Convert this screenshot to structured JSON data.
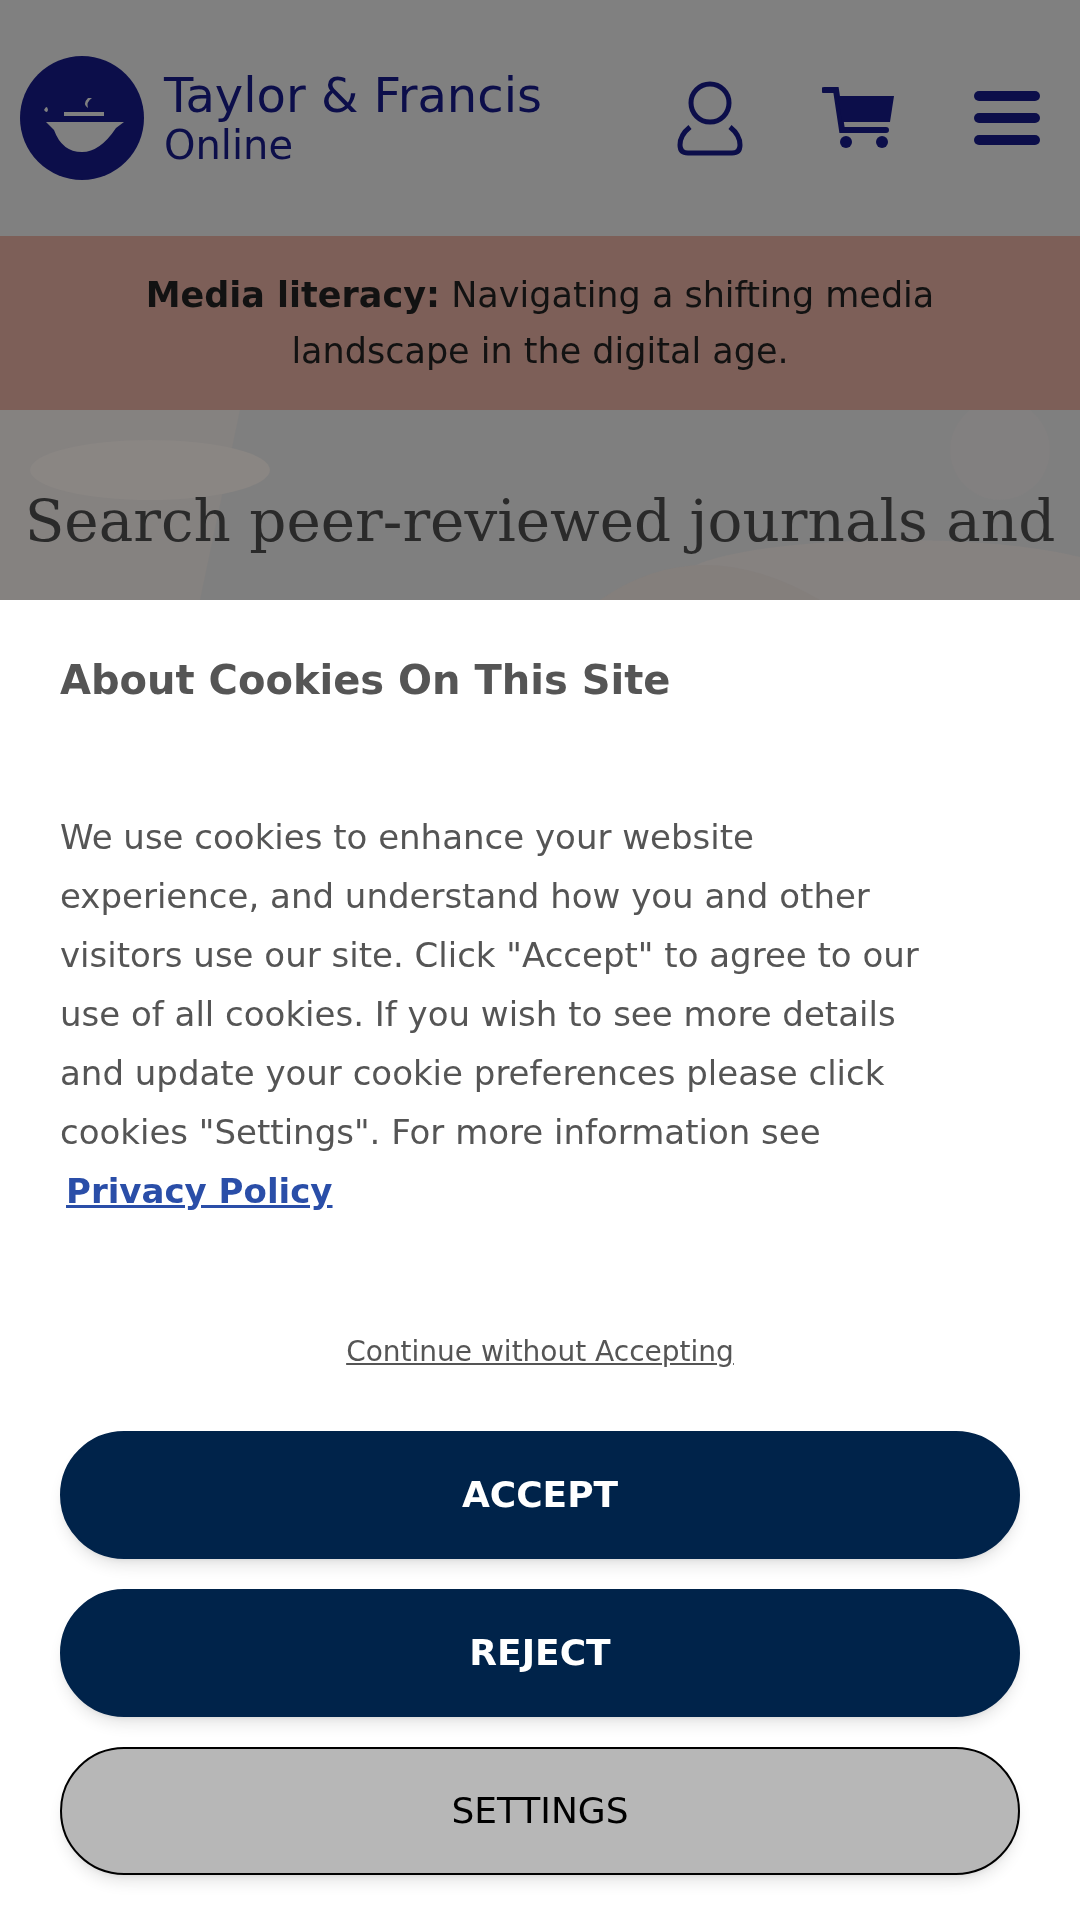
{
  "header": {
    "logo_title": "Taylor & Francis",
    "logo_subtitle": "Online"
  },
  "banner": {
    "lead": "Media literacy:",
    "text": "Navigating a shifting media landscape in the digital age."
  },
  "hero": {
    "heading": "Search peer-reviewed journals and"
  },
  "cookie_dialog": {
    "title": "About Cookies On This Site",
    "body": "We use cookies to enhance your website experience, and understand how you and other visitors use our site. Click \"Accept\" to agree to our use of all cookies. If you wish to see more details and update your cookie preferences please click cookies \"Settings\". For more information see",
    "link": "Privacy Policy",
    "continue_link": "Continue without Accepting",
    "buttons": [
      {
        "label": "ACCEPT",
        "kind": "primary"
      },
      {
        "label": "REJECT",
        "kind": "primary"
      },
      {
        "label": "SETTINGS",
        "kind": "secondary"
      }
    ]
  }
}
